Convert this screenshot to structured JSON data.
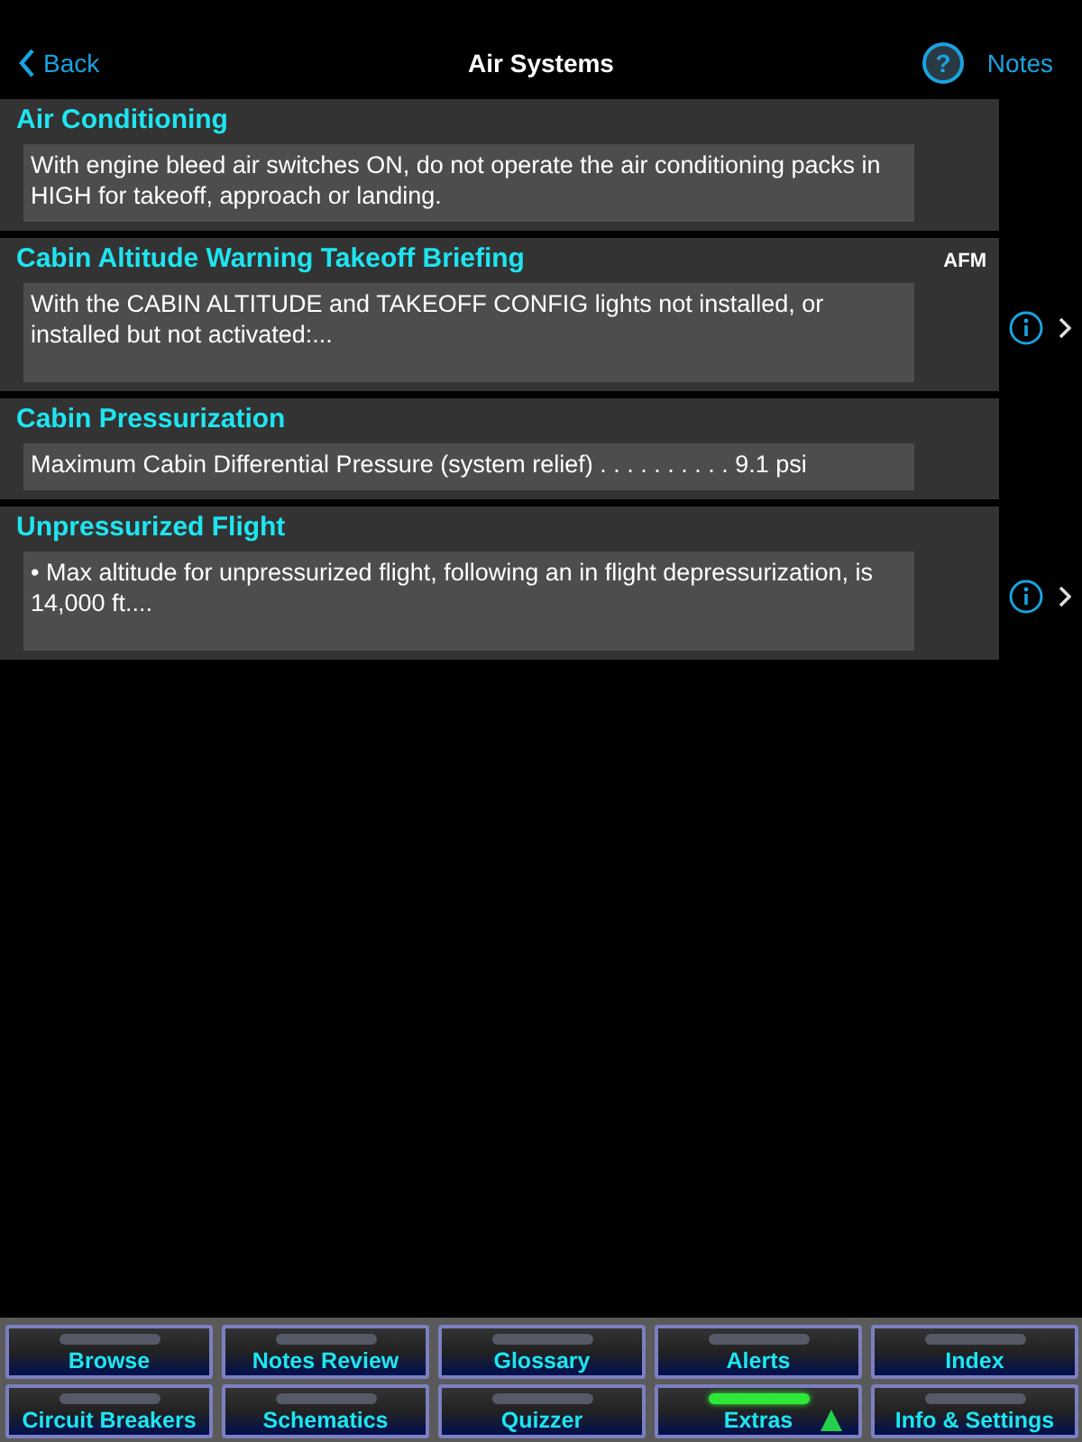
{
  "nav": {
    "back": "Back",
    "title": "Air Systems",
    "notes": "Notes",
    "help": "?"
  },
  "items": [
    {
      "title": "Air Conditioning",
      "text": "With engine bleed air switches ON, do not operate the air conditioning packs in HIGH for takeoff, approach or landing.",
      "info": false
    },
    {
      "title": "Cabin Altitude Warning Takeoff Briefing",
      "badge": "AFM",
      "text": "With the CABIN ALTITUDE and TAKEOFF CONFIG lights not installed, or installed but not activated:...",
      "info": true
    },
    {
      "title": "Cabin Pressurization",
      "text": "Maximum Cabin Differential Pressure (system relief) . . . . . . . . . . 9.1 psi",
      "info": false
    },
    {
      "title": "Unpressurized Flight",
      "text": "• Max altitude for unpressurized flight, following an in flight depressurization, is 14,000 ft....",
      "info": true
    }
  ],
  "toolbar": [
    {
      "label": "Browse",
      "selected": false,
      "has_menu": false
    },
    {
      "label": "Notes Review",
      "selected": false,
      "has_menu": false
    },
    {
      "label": "Glossary",
      "selected": false,
      "has_menu": false
    },
    {
      "label": "Alerts",
      "selected": false,
      "has_menu": false
    },
    {
      "label": "Index",
      "selected": false,
      "has_menu": false
    },
    {
      "label": "Circuit Breakers",
      "selected": false,
      "has_menu": false
    },
    {
      "label": "Schematics",
      "selected": false,
      "has_menu": false
    },
    {
      "label": "Quizzer",
      "selected": false,
      "has_menu": false
    },
    {
      "label": "Extras",
      "selected": true,
      "has_menu": true
    },
    {
      "label": "Info & Settings",
      "selected": false,
      "has_menu": false
    }
  ]
}
